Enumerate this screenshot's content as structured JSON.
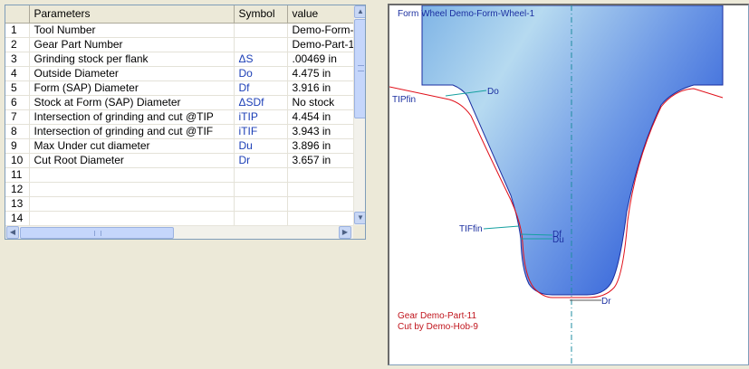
{
  "grid": {
    "columns": [
      "Parameters",
      "Symbol",
      "value"
    ],
    "rows": [
      {
        "num": "1",
        "param": "Tool Number",
        "symbol": "",
        "value": "Demo-Form-"
      },
      {
        "num": "2",
        "param": "Gear Part Number",
        "symbol": "",
        "value": "Demo-Part-1"
      },
      {
        "num": "3",
        "param": "Grinding stock per flank",
        "symbol": "ΔS",
        "value": ".00469 in"
      },
      {
        "num": "4",
        "param": "Outside Diameter",
        "symbol": "Do",
        "value": "4.475 in"
      },
      {
        "num": "5",
        "param": "Form (SAP) Diameter",
        "symbol": "Df",
        "value": "3.916 in"
      },
      {
        "num": "6",
        "param": "Stock at Form (SAP) Diameter",
        "symbol": "ΔSDf",
        "value": "No stock"
      },
      {
        "num": "7",
        "param": "Intersection of grinding and cut @TIP",
        "symbol": "iTIP",
        "value": "4.454 in"
      },
      {
        "num": "8",
        "param": "Intersection of grinding and cut @TIF",
        "symbol": "iTIF",
        "value": "3.943 in"
      },
      {
        "num": "9",
        "param": "Max Under cut diameter",
        "symbol": "Du",
        "value": "3.896 in"
      },
      {
        "num": "10",
        "param": "Cut Root Diameter",
        "symbol": "Dr",
        "value": "3.657 in"
      },
      {
        "num": "11",
        "param": "",
        "symbol": "",
        "value": ""
      },
      {
        "num": "12",
        "param": "",
        "symbol": "",
        "value": ""
      },
      {
        "num": "13",
        "param": "",
        "symbol": "",
        "value": ""
      },
      {
        "num": "14",
        "param": "",
        "symbol": "",
        "value": ""
      }
    ]
  },
  "drawing": {
    "title": "Form Wheel Demo-Form-Wheel-1",
    "labels": {
      "tip": "TIPfin",
      "tif": "TIFfin",
      "do": "Do",
      "df": "Df",
      "du": "Du",
      "dr": "Dr"
    },
    "footer_line1": "Gear Demo-Part-11",
    "footer_line2": "Cut by Demo-Hob-9",
    "colors": {
      "title": "#1b2fa0",
      "footer": "#c0141c",
      "wheel_fill": "#4f7ee0",
      "gear_profile": "#e0101a",
      "centerline": "#1e8ca0",
      "leader": "#15a0a0"
    }
  },
  "icons": {
    "scroll_up": "triangle-up-icon",
    "scroll_down": "triangle-down-icon",
    "scroll_left": "triangle-left-icon",
    "scroll_right": "triangle-right-icon"
  }
}
